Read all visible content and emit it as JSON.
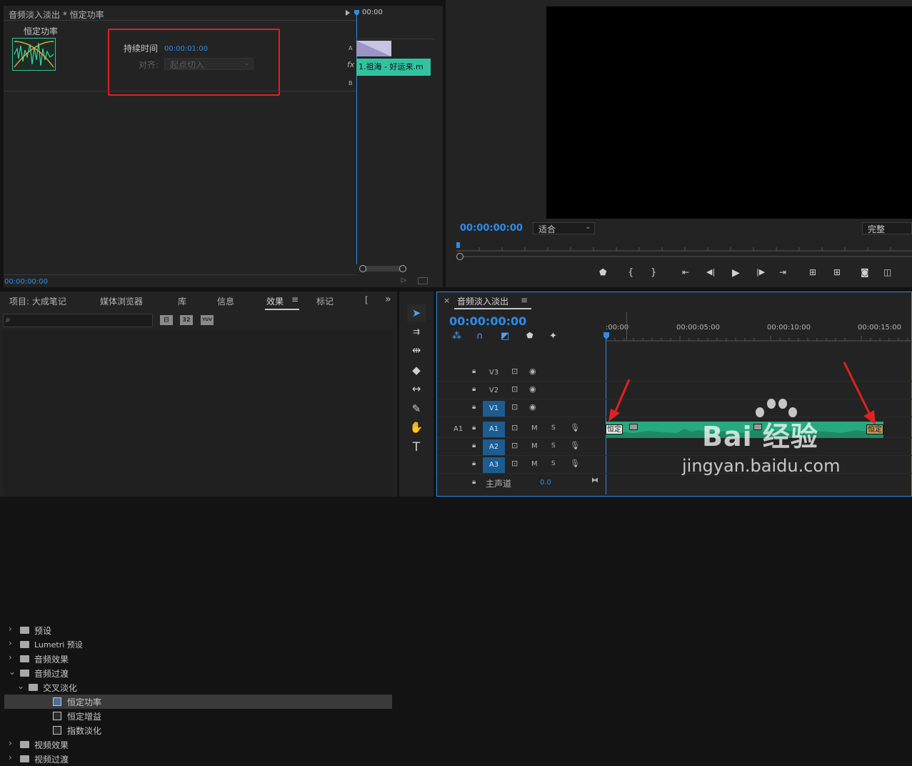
{
  "effect_controls": {
    "header_title": "音频淡入淡出 * 恒定功率",
    "effect_name": "恒定功率",
    "duration_label": "持续时间",
    "duration_value": "00:00:01:00",
    "align_label": "对齐:",
    "align_value": "起点切入",
    "mini_timeline_time": "00:00",
    "track_a": "A",
    "track_b": "B",
    "fx_label": "fx",
    "clip_name": "1.祖海 - 好运来.m",
    "current_time": "00:00:00:00"
  },
  "program_monitor": {
    "timecode": "00:00:00:00",
    "fit_value": "适合",
    "quality_value": "完整"
  },
  "project_panel": {
    "tabs": [
      "项目: 大成笔记",
      "媒体浏览器",
      "库",
      "信息",
      "效果",
      "标记",
      "["
    ],
    "active_tab": "效果",
    "more_icon": "»",
    "preset_icons": [
      "⊟",
      "32",
      "YUV"
    ],
    "tree": [
      {
        "label": "预设",
        "level": 0,
        "type": "folder-star",
        "chev": "›"
      },
      {
        "label": "Lumetri 预设",
        "level": 0,
        "type": "folder-star",
        "chev": "›"
      },
      {
        "label": "音频效果",
        "level": 0,
        "type": "folder",
        "chev": "›"
      },
      {
        "label": "音频过渡",
        "level": 0,
        "type": "folder",
        "chev": "⌄"
      },
      {
        "label": "交叉淡化",
        "level": 1,
        "type": "folder",
        "chev": "⌄"
      },
      {
        "label": "恒定功率",
        "level": 2,
        "type": "effect",
        "chev": ""
      },
      {
        "label": "恒定增益",
        "level": 2,
        "type": "effect",
        "chev": ""
      },
      {
        "label": "指数淡化",
        "level": 2,
        "type": "effect",
        "chev": ""
      },
      {
        "label": "视频效果",
        "level": 0,
        "type": "folder",
        "chev": "›"
      },
      {
        "label": "视频过渡",
        "level": 0,
        "type": "folder",
        "chev": "›"
      }
    ],
    "selected_index": 5
  },
  "timeline": {
    "close": "×",
    "title": "音频淡入淡出",
    "menu": "≡",
    "timecode": "00:00:00:00",
    "ruler": [
      ":00:00",
      "00:00:05:00",
      "00:00:10:00",
      "00:00:15:00"
    ],
    "tracks": [
      {
        "label": "V3",
        "kind": "video",
        "src": "",
        "on": false
      },
      {
        "label": "V2",
        "kind": "video",
        "src": "",
        "on": false
      },
      {
        "label": "V1",
        "kind": "video",
        "src": "",
        "on": true
      },
      {
        "label": "A1",
        "kind": "audio",
        "src": "A1",
        "on": true
      },
      {
        "label": "A2",
        "kind": "audio",
        "src": "",
        "on": true
      },
      {
        "label": "A3",
        "kind": "audio",
        "src": "",
        "on": true
      }
    ],
    "master_label": "主声道",
    "master_value": "0.0",
    "mute": "M",
    "solo": "S",
    "transition_start": "恒定",
    "transition_end": "恒定"
  },
  "watermark": {
    "brand": "Bai 经验",
    "url": "jingyan.baidu.com"
  },
  "colors": {
    "accent_blue": "#2d8ceb",
    "clip_green": "#27a97f",
    "highlight_red": "#e1201f"
  }
}
